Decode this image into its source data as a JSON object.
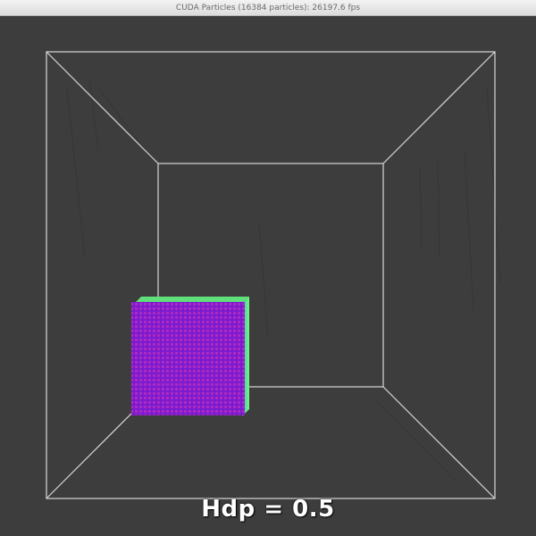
{
  "window": {
    "title": "CUDA Particles (16384 particles): 26197.6 fps"
  },
  "overlay": {
    "caption": "Hdp = 0.5"
  },
  "colors": {
    "background": "#3d3d3d",
    "box_lines": "#d8d8d8",
    "particle_main": "#8a1fd6",
    "particle_dot": "#b22bbf",
    "particle_edge_green": "#7cf07a",
    "particle_edge_cyan": "#55e6e6",
    "caption_text": "#ffffff"
  }
}
